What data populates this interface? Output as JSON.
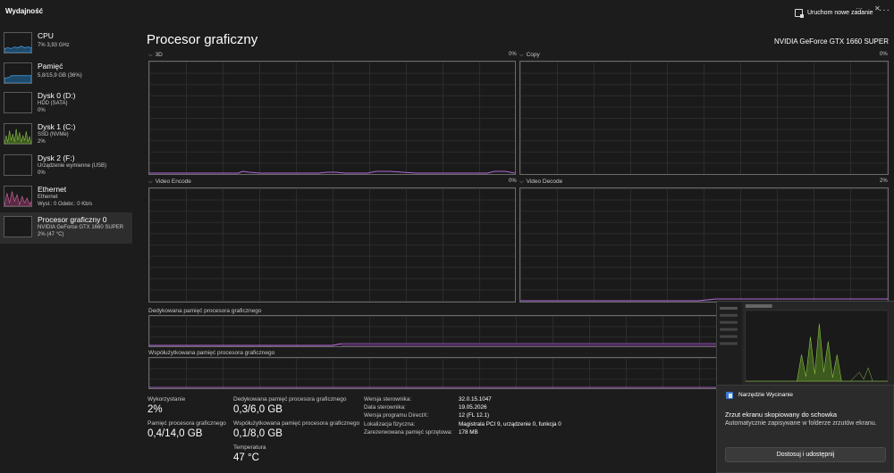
{
  "app": {
    "title": "Wydajność",
    "run_task": "Uruchom nowe zadanie",
    "more": "···"
  },
  "sidebar": {
    "items": [
      {
        "name": "CPU",
        "line1": "7% 3,93 GHz",
        "line2": "",
        "color": "#4aa0e6"
      },
      {
        "name": "Pamięć",
        "line1": "5,8/15,9 GB (36%)",
        "line2": "",
        "color": "#4aa0e6"
      },
      {
        "name": "Dysk 0 (D:)",
        "line1": "HDD (SATA)",
        "line2": "0%",
        "color": "#8bc34a"
      },
      {
        "name": "Dysk 1 (C:)",
        "line1": "SSD (NVMe)",
        "line2": "2%",
        "color": "#8bc34a"
      },
      {
        "name": "Dysk 2 (F:)",
        "line1": "Urządzenie wymienne (USB)",
        "line2": "0%",
        "color": "#8bc34a"
      },
      {
        "name": "Ethernet",
        "line1": "Ethernet",
        "line2": "Wysł.: 0 Odebr.: 0 Kb/s",
        "color": "#d86ea8"
      },
      {
        "name": "Procesor graficzny 0",
        "line1": "NVIDIA GeForce GTX 1660 SUPER",
        "line2": "2% (47 °C)",
        "color": "#b26ad8"
      }
    ]
  },
  "main": {
    "title": "Procesor graficzny",
    "gpu_name": "NVIDIA GeForce GTX 1660 SUPER",
    "accent": "#b26ad8",
    "graphs": {
      "g3d": {
        "label": "3D",
        "pct": "0%"
      },
      "copy": {
        "label": "Copy",
        "pct": "0%"
      },
      "encode": {
        "label": "Video Encode",
        "pct": "0%"
      },
      "decode": {
        "label": "Video Decode",
        "pct": "2%"
      }
    },
    "dedicated_label": "Dedykowana pamięć procesora graficznego",
    "shared_label": "Współużytkowana pamięć procesora graficznego"
  },
  "stats": {
    "usage_label": "Wykorzystanie",
    "usage_value": "2%",
    "gpu_mem_label": "Pamięć procesora graficznego",
    "gpu_mem_value": "0,4/14,0 GB",
    "dedicated_label": "Dedykowana pamięć procesora graficznego",
    "dedicated_value": "0,3/6,0 GB",
    "shared_label": "Współużytkowana pamięć procesora graficznego",
    "shared_value": "0,1/8,0 GB",
    "temp_label": "Temperatura",
    "temp_value": "47 °C"
  },
  "properties": [
    {
      "key": "Wersja sterownika:",
      "value": "32.0.15.1047"
    },
    {
      "key": "Data sterownika:",
      "value": "19.05.2026"
    },
    {
      "key": "Wersja programu DirectX:",
      "value": "12 (FL 12.1)"
    },
    {
      "key": "Lokalizacja fizyczna:",
      "value": "Magistrala PCI 9, urządzenie 0, funkcja 0"
    },
    {
      "key": "Zarezerwowana pamięć sprzętowa:",
      "value": "178 MB"
    }
  ],
  "toast": {
    "app_name": "Narzędzie Wycinanie",
    "more": "···",
    "close": "✕",
    "heading": "Zrzut ekranu skopiowany do schowka",
    "body": "Automatycznie zapisywane w folderze zrzutów ekranu.",
    "button": "Dostosuj i udostępnij"
  }
}
